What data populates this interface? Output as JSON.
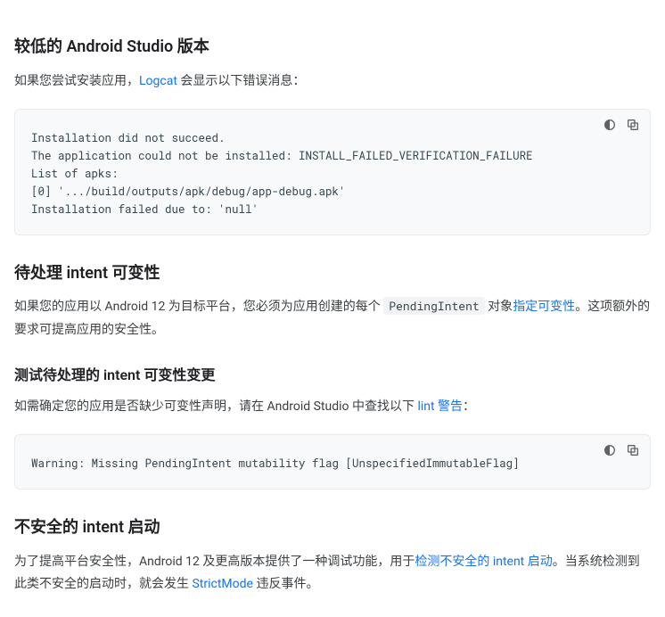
{
  "section1": {
    "heading": "较低的 Android Studio 版本",
    "p_prefix": "如果您尝试安装应用，",
    "p_link": "Logcat",
    "p_suffix": " 会显示以下错误消息：",
    "code": "Installation did not succeed.\nThe application could not be installed: INSTALL_FAILED_VERIFICATION_FAILURE\nList of apks:\n[0] '.../build/outputs/apk/debug/app-debug.apk'\nInstallation failed due to: 'null'"
  },
  "section2": {
    "heading": "待处理 intent 可变性",
    "p_prefix": "如果您的应用以 Android 12 为目标平台，您必须为应用创建的每个 ",
    "p_code": "PendingIntent",
    "p_mid": " 对象",
    "p_link": "指定可变性",
    "p_suffix": "。这项额外的要求可提高应用的安全性。"
  },
  "section3": {
    "heading": "测试待处理的 intent 可变性变更",
    "p_prefix": "如需确定您的应用是否缺少可变性声明，请在 Android Studio 中查找以下 ",
    "p_link": "lint 警告",
    "p_suffix": "：",
    "code": "Warning: Missing PendingIntent mutability flag [UnspecifiedImmutableFlag]"
  },
  "section4": {
    "heading": "不安全的 intent 启动",
    "p_prefix": "为了提高平台安全性，Android 12 及更高版本提供了一种调试功能，用于",
    "p_link1": "检测不安全的 intent 启动",
    "p_mid": "。当系统检测到此类不安全的启动时，就会发生 ",
    "p_link2": "StrictMode",
    "p_suffix": " 违反事件。"
  },
  "icons": {
    "theme": "toggle-theme",
    "copy": "copy-code"
  }
}
